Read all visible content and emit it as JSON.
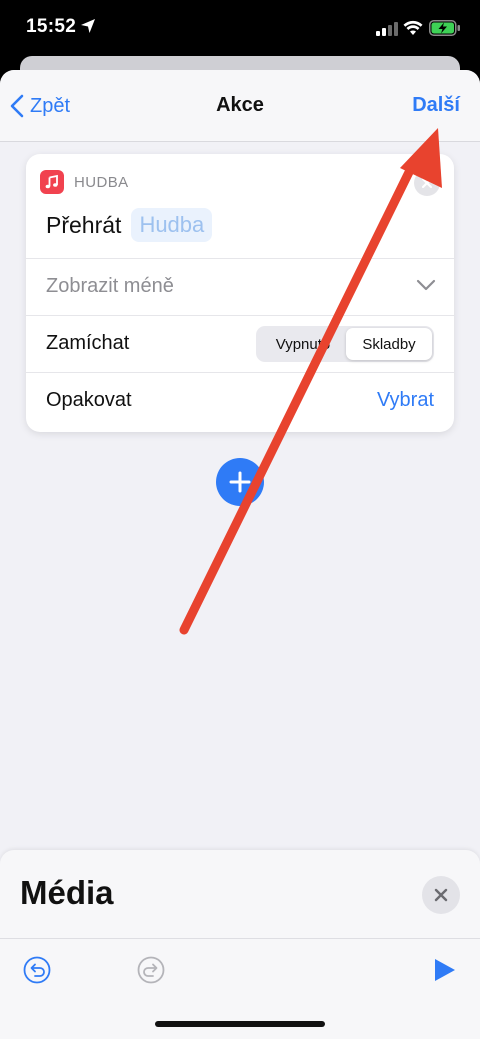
{
  "status": {
    "time": "15:52"
  },
  "nav": {
    "back_label": "Zpět",
    "title": "Akce",
    "next_label": "Další"
  },
  "card": {
    "app_name": "HUDBA",
    "action": "Přehrát",
    "param_placeholder": "Hudba",
    "show_less": "Zobrazit méně",
    "shuffle_label": "Zamíchat",
    "shuffle_options": [
      "Vypnuto",
      "Skladby"
    ],
    "shuffle_selected": "Skladby",
    "repeat_label": "Opakovat",
    "repeat_action": "Vybrat"
  },
  "panel": {
    "title": "Média"
  },
  "colors": {
    "accent": "#2f7bf6",
    "music_app": "#f1424f",
    "annotation_arrow": "#e8432e"
  },
  "icons": {
    "location": "location-arrow-icon",
    "signal": "cellular-signal-icon",
    "wifi": "wifi-icon",
    "battery": "battery-charging-icon",
    "back": "chevron-left-icon",
    "music": "music-note-icon",
    "close": "close-icon",
    "expand": "chevron-down-icon",
    "add": "plus-icon",
    "undo": "undo-icon",
    "redo": "redo-icon",
    "play": "play-icon"
  }
}
